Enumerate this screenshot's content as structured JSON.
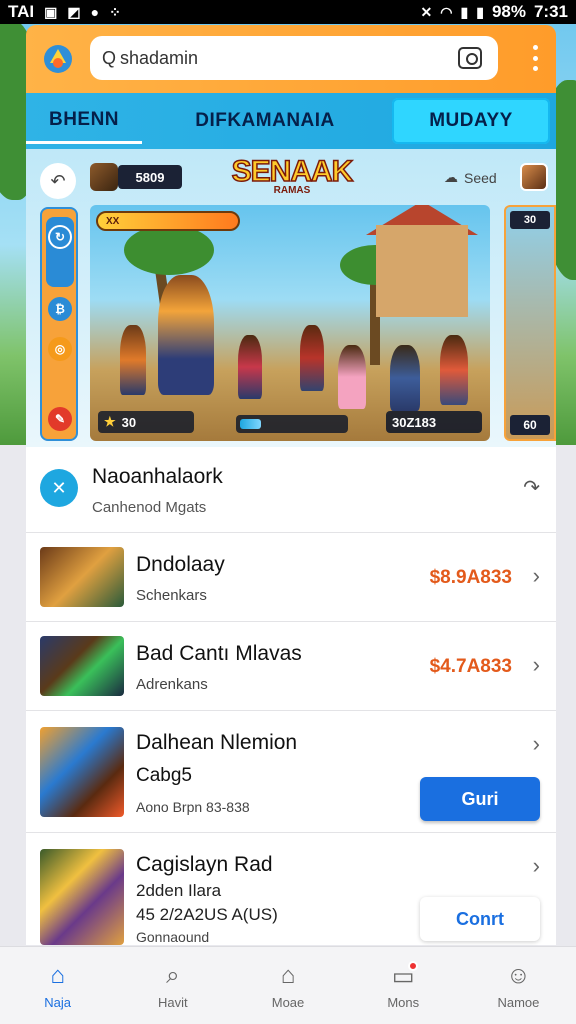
{
  "status_bar": {
    "carrier": "TAI",
    "battery": "98%",
    "time": "7:31"
  },
  "header": {
    "search_value": "shadamin"
  },
  "tabs": [
    {
      "label": "BHENN"
    },
    {
      "label": "DIFKAMANAIA"
    },
    {
      "label": "MUDAYY"
    }
  ],
  "banner": {
    "mini_count": "5809",
    "game_logo_title": "SENAAK",
    "game_logo_sub": "RAMAS",
    "seed_label": "Seed",
    "flag_text": "XX",
    "score": "30",
    "player_count": "30Z183",
    "right_badge": "30",
    "right_count": "60"
  },
  "section": {
    "title": "Naoanhalaork",
    "subtitle": "Canhenod Mgats"
  },
  "rows": [
    {
      "title": "Dndolaay",
      "subtitle": "Schenkars",
      "price": "$8.9A833"
    },
    {
      "title": "Bad Cantı Mlavas",
      "subtitle": "Adrenkans",
      "price": "$4.7A833"
    },
    {
      "title": "Dalhean Nlemion",
      "line2": "Cabg5",
      "subtitle": "Aono Brpn 83-838",
      "button": "Guri"
    },
    {
      "title": "Cagislayn Rad",
      "line2": "2dden Ilara",
      "line3": "45 2/2A2US A(US)",
      "subtitle": "Gonnaound",
      "button": "Conrt"
    }
  ],
  "bottom_nav": [
    {
      "label": "Naja",
      "icon": "home-icon",
      "active": true
    },
    {
      "label": "Havit",
      "icon": "search-icon",
      "active": false
    },
    {
      "label": "Moae",
      "icon": "store-icon",
      "active": false
    },
    {
      "label": "Mons",
      "icon": "notifications-icon",
      "active": false
    },
    {
      "label": "Namoe",
      "icon": "profile-icon",
      "active": false
    }
  ],
  "colors": {
    "accent_orange": "#ff9c2a",
    "tab_blue": "#1ea7e0",
    "primary_button": "#1a6fe0",
    "price_orange": "#e35a1b"
  },
  "banner_progress": 0.2
}
